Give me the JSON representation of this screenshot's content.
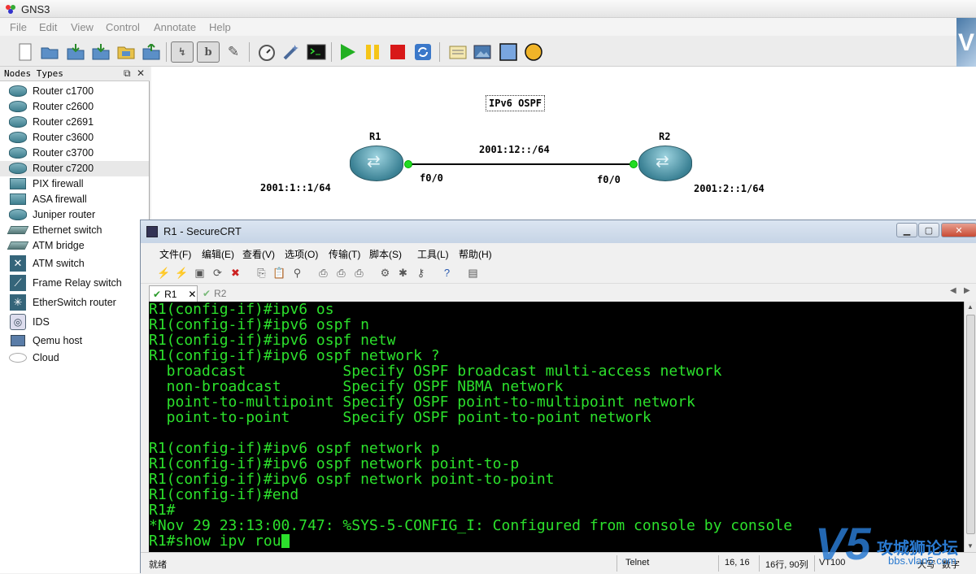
{
  "app": {
    "title": "GNS3"
  },
  "menu": [
    "File",
    "Edit",
    "View",
    "Control",
    "Annotate",
    "Help"
  ],
  "toolbar_icons": [
    "new-file-icon",
    "open-folder-icon",
    "save-icon",
    "save-as-icon",
    "open-project-icon",
    "export-icon",
    "show-hostnames-icon",
    "show-interface-labels-icon",
    "add-link-icon",
    "stopwatch-icon",
    "wand-icon",
    "console-icon",
    "start-icon",
    "suspend-icon",
    "stop-icon",
    "reload-icon",
    "note-icon",
    "screenshot-icon",
    "rectangle-icon",
    "ellipse-icon"
  ],
  "colors": {
    "terminal_text": "#2ce02c",
    "terminal_bg": "#000000",
    "start": "#22b022",
    "suspend": "#f5c518",
    "stop": "#d81818"
  },
  "nodes_panel": {
    "title": "Nodes Types",
    "items": [
      {
        "label": "Router c1700",
        "icon": "router-icon"
      },
      {
        "label": "Router c2600",
        "icon": "router-icon"
      },
      {
        "label": "Router c2691",
        "icon": "router-icon"
      },
      {
        "label": "Router c3600",
        "icon": "router-icon"
      },
      {
        "label": "Router c3700",
        "icon": "router-icon"
      },
      {
        "label": "Router c7200",
        "icon": "router-icon",
        "selected": true
      },
      {
        "label": "PIX firewall",
        "icon": "firewall-icon"
      },
      {
        "label": "ASA firewall",
        "icon": "firewall-icon"
      },
      {
        "label": "Juniper router",
        "icon": "router-icon"
      },
      {
        "label": "Ethernet switch",
        "icon": "switch-icon"
      },
      {
        "label": "ATM bridge",
        "icon": "switch-icon"
      },
      {
        "label": "ATM switch",
        "icon": "atm-switch-icon"
      },
      {
        "label": "Frame Relay switch",
        "icon": "frame-relay-icon"
      },
      {
        "label": "EtherSwitch router",
        "icon": "etherswitch-icon"
      },
      {
        "label": "IDS",
        "icon": "ids-icon"
      },
      {
        "label": "Qemu host",
        "icon": "host-icon"
      },
      {
        "label": "Cloud",
        "icon": "cloud-icon"
      }
    ]
  },
  "topology": {
    "note": "IPv6 OSPF",
    "r1": {
      "name": "R1",
      "iface": "f0/0",
      "addr": "2001:1::1/64"
    },
    "r2": {
      "name": "R2",
      "iface": "f0/0",
      "addr": "2001:2::1/64"
    },
    "link": "2001:12::/64"
  },
  "securecrt": {
    "title": "R1 - SecureCRT",
    "menu": [
      "文件(F)",
      "编辑(E)",
      "查看(V)",
      "选项(O)",
      "传输(T)",
      "脚本(S)",
      "工具(L)",
      "帮助(H)"
    ],
    "tabs": [
      "R1",
      "R2"
    ],
    "terminal_lines": [
      "R1(config-if)#ipv6 os",
      "R1(config-if)#ipv6 ospf n",
      "R1(config-if)#ipv6 ospf netw",
      "R1(config-if)#ipv6 ospf network ?",
      "  broadcast           Specify OSPF broadcast multi-access network",
      "  non-broadcast       Specify OSPF NBMA network",
      "  point-to-multipoint Specify OSPF point-to-multipoint network",
      "  point-to-point      Specify OSPF point-to-point network",
      "",
      "R1(config-if)#ipv6 ospf network p",
      "R1(config-if)#ipv6 ospf network point-to-p",
      "R1(config-if)#ipv6 ospf network point-to-point",
      "R1(config-if)#end",
      "R1#",
      "*Nov 29 23:13:00.747: %SYS-5-CONFIG_I: Configured from console by console",
      "R1#show ipv rou"
    ],
    "status": {
      "ready": "就绪",
      "protocol": "Telnet",
      "cursor": "16, 16",
      "rowcol": "16行, 90列",
      "term": "VT100",
      "caps": "大写",
      "num": "数字"
    }
  },
  "watermark": {
    "brand": "攻城狮论坛",
    "url": "bbs.vlan5.com"
  }
}
